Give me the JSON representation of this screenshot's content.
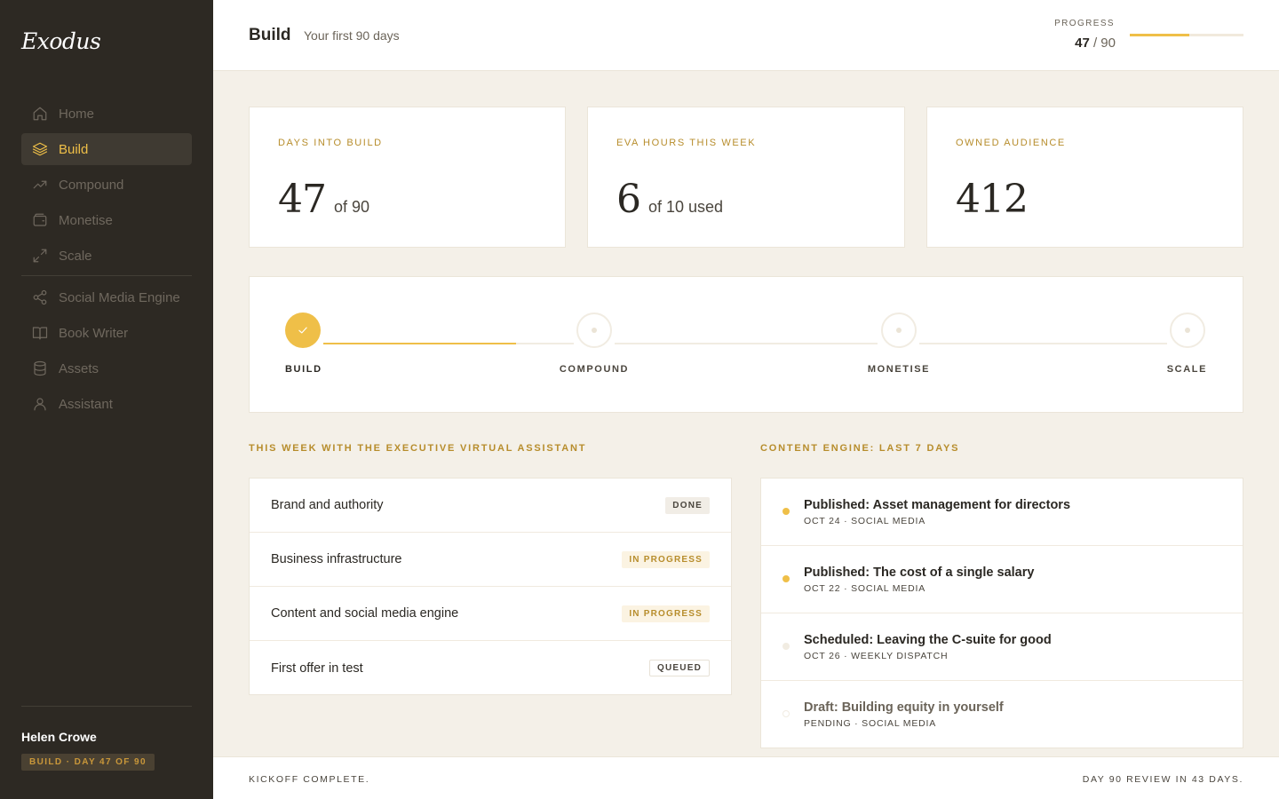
{
  "app": {
    "logo": "Exodus"
  },
  "sidebar": {
    "items": [
      {
        "label": "Home",
        "icon": "home-icon"
      },
      {
        "label": "Build",
        "icon": "layers-icon",
        "active": true
      },
      {
        "label": "Compound",
        "icon": "trending-up-icon"
      },
      {
        "label": "Monetise",
        "icon": "wallet-icon"
      },
      {
        "label": "Scale",
        "icon": "expand-icon"
      }
    ],
    "tools": [
      {
        "label": "Social Media Engine",
        "icon": "share-icon"
      },
      {
        "label": "Book Writer",
        "icon": "book-icon"
      },
      {
        "label": "Assets",
        "icon": "database-icon"
      },
      {
        "label": "Assistant",
        "icon": "user-icon"
      }
    ],
    "user": {
      "name": "Helen Crowe",
      "badge": "BUILD · DAY 47 OF 90"
    }
  },
  "header": {
    "title": "Build",
    "subtitle": "Your first 90 days",
    "progress_label": "PROGRESS",
    "progress_current": "47",
    "progress_total": "/ 90",
    "progress_fraction": 0.52
  },
  "stats": [
    {
      "label": "DAYS INTO BUILD",
      "value": "47",
      "suffix": "of 90"
    },
    {
      "label": "EVA HOURS THIS WEEK",
      "value": "6",
      "suffix": "of 10 used"
    },
    {
      "label": "OWNED AUDIENCE",
      "value": "412",
      "suffix": ""
    }
  ],
  "phases": [
    {
      "label": "BUILD",
      "status": "done"
    },
    {
      "label": "COMPOUND",
      "status": "todo"
    },
    {
      "label": "MONETISE",
      "status": "todo"
    },
    {
      "label": "SCALE",
      "status": "todo"
    }
  ],
  "tasks": {
    "title": "THIS WEEK WITH THE EXECUTIVE VIRTUAL ASSISTANT",
    "items": [
      {
        "name": "Brand and authority",
        "status": "DONE"
      },
      {
        "name": "Business infrastructure",
        "status": "IN PROGRESS"
      },
      {
        "name": "Content and social media engine",
        "status": "IN PROGRESS"
      },
      {
        "name": "First offer in test",
        "status": "QUEUED"
      }
    ]
  },
  "content": {
    "title": "CONTENT ENGINE: LAST 7 DAYS",
    "items": [
      {
        "title": "Published: Asset management for directors",
        "meta": "OCT 24 · SOCIAL MEDIA",
        "state": "published"
      },
      {
        "title": "Published: The cost of a single salary",
        "meta": "OCT 22 · SOCIAL MEDIA",
        "state": "published"
      },
      {
        "title": "Scheduled: Leaving the C-suite for good",
        "meta": "OCT 26 · WEEKLY DISPATCH",
        "state": "scheduled"
      },
      {
        "title": "Draft: Building equity in yourself",
        "meta": "PENDING · SOCIAL MEDIA",
        "state": "draft"
      }
    ]
  },
  "footer": {
    "left": "KICKOFF COMPLETE.",
    "right": "DAY 90 REVIEW IN 43 DAYS."
  },
  "colors": {
    "accent": "#efbf48",
    "accent_text": "#b78d2c",
    "sidebar_bg": "#2d2923",
    "page_bg": "#f4f0e8"
  }
}
